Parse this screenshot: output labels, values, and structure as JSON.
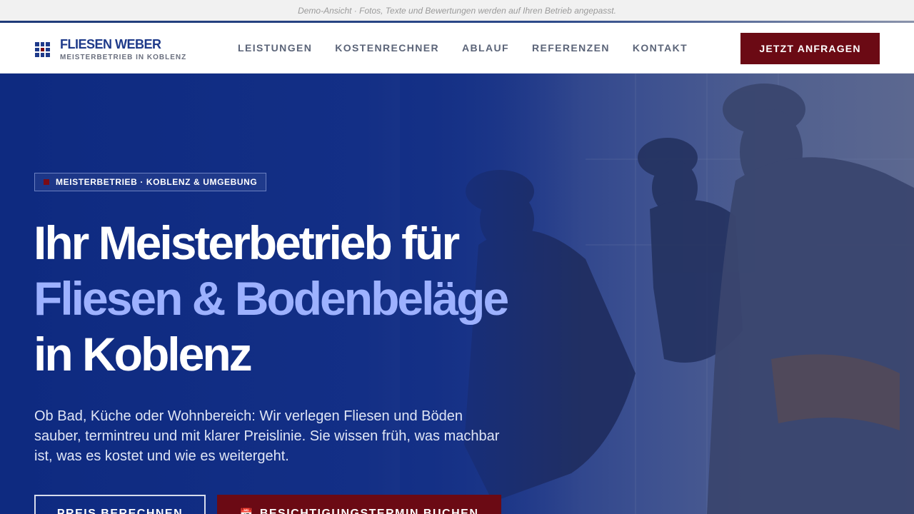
{
  "demo_notice": "Demo-Ansicht · Fotos, Texte und Bewertungen werden auf Ihren Betrieb angepasst.",
  "brand": {
    "name": "FLIESEN WEBER",
    "tagline": "MEISTERBETRIEB IN KOBLENZ"
  },
  "nav": [
    "LEISTUNGEN",
    "KOSTENRECHNER",
    "ABLAUF",
    "REFERENZEN",
    "KONTAKT"
  ],
  "header_cta": "JETZT ANFRAGEN",
  "hero": {
    "badge": "MEISTERBETRIEB · KOBLENZ & UMGEBUNG",
    "headline_line1": "Ihr Meisterbetrieb für",
    "headline_line2": "Fliesen & Bodenbeläge",
    "headline_line3": "in Koblenz",
    "lead": "Ob Bad, Küche oder Wohnbereich: Wir verlegen Fliesen und Böden sauber, termintreu und mit klarer Preislinie. Sie wissen früh, was machbar ist, was es kostet und wie es weitergeht.",
    "button_primary": "PREIS BERECHNEN",
    "button_secondary": "BESICHTIGUNGSTERMIN BUCHEN"
  },
  "colors": {
    "brand_blue": "#1e3a8a",
    "accent_red": "#6b0a14",
    "hero_blue": "#132f86",
    "headline_accent": "#9db1ff"
  },
  "icons": {
    "logo": "tile-grid-icon",
    "calendar": "calendar-icon"
  }
}
